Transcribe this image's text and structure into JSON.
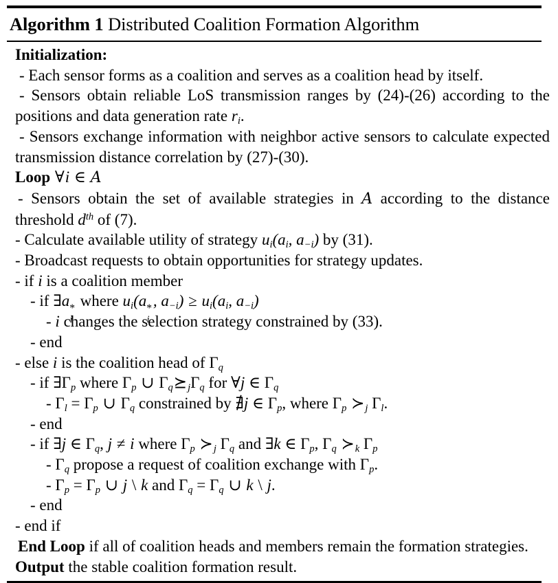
{
  "title": {
    "keyword": "Algorithm 1",
    "name": "Distributed Coalition Formation Algorithm"
  },
  "sections": {
    "initialization_label": "Initialization:",
    "loop_label": "Loop",
    "end_loop_label": "End Loop",
    "output_label": "Output"
  },
  "lines": {
    "init_1": "- Each sensor forms as a coalition and serves as a coalition head by itself.",
    "init_2_a": "- Sensors obtain reliable LoS transmission ranges by (24)-(26) according to the positions and data generation rate ",
    "init_2_b": "r",
    "init_2_c": "i",
    "init_2_d": ".",
    "init_3": "- Sensors exchange information with neighbor active sensors to calculate expected transmission distance correlation by (27)-(30).",
    "loop_header_quantifier": "∀",
    "loop_header_var": "i",
    "loop_header_in": "∈",
    "loop_header_set": "A",
    "loop_1_a": "- Sensors obtain the set of available strategies in ",
    "loop_1_set": "A",
    "loop_1_b": " according to the distance threshold ",
    "loop_1_d": "d",
    "loop_1_th": "th",
    "loop_1_c": " of (7).",
    "calc_a": "- Calculate available utility of strategy ",
    "calc_u": "u",
    "calc_usub": "i",
    "calc_args": "(a",
    "calc_args_sub": "i",
    "calc_args2": ", a",
    "calc_args2_sub": "−i",
    "calc_args3": ")",
    "calc_b": " by (31).",
    "broadcast": "- Broadcast requests to obtain opportunities for strategy updates.",
    "if_member_a": "- if ",
    "if_member_i": "i",
    "if_member_b": " is a coalition member",
    "if_exists_a": "- if ∃",
    "if_exists_var": "a",
    "if_exists_star": "*",
    "if_exists_sub": "i",
    "if_exists_b": " where ",
    "if_exists_u1": "u",
    "if_exists_u1sub": "i",
    "if_exists_args1": "(a",
    "if_exists_args1_star": "*",
    "if_exists_args1_sub": "i",
    "if_exists_args1b": ", a",
    "if_exists_args1b_sub": "−i",
    "if_exists_args1c": ")",
    "if_exists_geq": "≥",
    "if_exists_u2": "u",
    "if_exists_u2sub": "i",
    "if_exists_args2": "(a",
    "if_exists_args2_sub": "i",
    "if_exists_args2b": ", a",
    "if_exists_args2b_sub": "−i",
    "if_exists_args2c": ")",
    "change_a": "- ",
    "change_i": "i",
    "change_b": " changes the selection strategy constrained by (33).",
    "end_1": "- end",
    "else_head_a": "- else ",
    "else_head_i": "i",
    "else_head_b": " is the coalition head of ",
    "else_head_gamma": "Γ",
    "else_head_sub": "q",
    "if_gp_a": "- if ∃Γ",
    "if_gp_sub": "p",
    "if_gp_b": " where Γ",
    "if_gp_sub2": "p",
    "if_gp_cup": "∪",
    "if_gp_c": "Γ",
    "if_gp_sub3": "q",
    "if_gp_succeq": "⪰",
    "if_gp_succeq_sub": "j",
    "if_gp_d": "Γ",
    "if_gp_sub4": "q",
    "if_gp_e": " for ∀",
    "if_gp_j": "j",
    "if_gp_f": " ∈ Γ",
    "if_gp_sub5": "q",
    "gl_a": "- Γ",
    "gl_sub": "l",
    "gl_eq": " = Γ",
    "gl_sub2": "p",
    "gl_cup": " ∪ ",
    "gl_c": "Γ",
    "gl_sub3": "q",
    "gl_d": " constrained by ∄",
    "gl_j": "j",
    "gl_e": " ∈ Γ",
    "gl_sub4": "p",
    "gl_f": ", where Γ",
    "gl_sub5": "p",
    "gl_succ": " ≻",
    "gl_succ_sub": "j",
    "gl_g": " Γ",
    "gl_sub6": "l",
    "gl_h": ".",
    "end_2": "- end",
    "if_j_a": "- if ∃",
    "if_j_j": "j",
    "if_j_b": " ∈ Γ",
    "if_j_sub": "q",
    "if_j_c": ", ",
    "if_j_j2": "j",
    "if_j_neq": " ≠ ",
    "if_j_i": "i",
    "if_j_d": " where Γ",
    "if_j_sub2": "p",
    "if_j_succ": " ≻",
    "if_j_succ_sub": "j",
    "if_j_e": " Γ",
    "if_j_sub3": "q",
    "if_j_f": " and ∃",
    "if_j_k": "k",
    "if_j_g": " ∈ Γ",
    "if_j_sub4": "p",
    "if_j_h": ", Γ",
    "if_j_sub5": "q",
    "if_j_succ2": " ≻",
    "if_j_succ2_sub": "k",
    "if_j_i2": " Γ",
    "if_j_sub6": "p",
    "propose_a": "- Γ",
    "propose_sub": "q",
    "propose_b": " propose a request of coalition exchange with Γ",
    "propose_sub2": "p",
    "propose_c": ".",
    "assign_a": "- Γ",
    "assign_sub": "p",
    "assign_b": " = Γ",
    "assign_sub2": "p",
    "assign_cup": " ∪ ",
    "assign_j": "j",
    "assign_bs": " \\ ",
    "assign_k": "k",
    "assign_c": " and Γ",
    "assign_sub3": "q",
    "assign_d": " = Γ",
    "assign_sub4": "q",
    "assign_cup2": " ∪ ",
    "assign_k2": "k",
    "assign_bs2": " \\ ",
    "assign_j2": "j",
    "assign_e": ".",
    "end_3": "- end",
    "end_if": "- end if",
    "end_loop_text": " if all of coalition heads and members remain the formation strategies.",
    "output_text": " the stable coalition formation result."
  }
}
